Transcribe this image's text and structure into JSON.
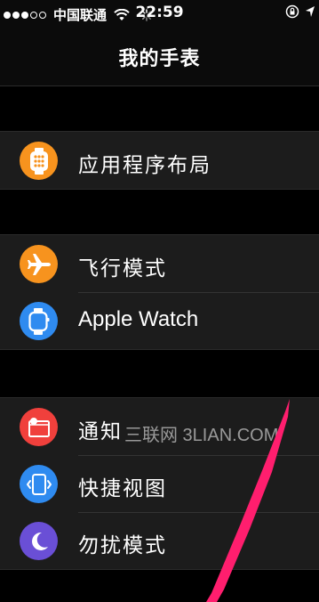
{
  "status_bar": {
    "carrier": "中国联通",
    "time": "22:59",
    "signal_dots_filled": 3,
    "signal_dots_total": 5
  },
  "nav": {
    "title": "我的手表"
  },
  "groups": [
    [
      {
        "label": "应用程序布局",
        "icon": "watch-app-grid-icon",
        "color": "#f7931e"
      }
    ],
    [
      {
        "label": "飞行模式",
        "icon": "airplane-icon",
        "color": "#f7931e"
      },
      {
        "label": "Apple Watch",
        "icon": "apple-watch-icon",
        "color": "#2f8bf0"
      }
    ],
    [
      {
        "label": "通知",
        "icon": "notification-icon",
        "color": "#f0403c"
      },
      {
        "label": "快捷视图",
        "icon": "glances-icon",
        "color": "#2f8bf0"
      },
      {
        "label": "勿扰模式",
        "icon": "moon-icon",
        "color": "#6a4fd6"
      }
    ]
  ],
  "watermark": "三联网 3LIAN.COM",
  "colors": {
    "background": "#000000",
    "cell": "#1c1c1c",
    "annotation": "#ff1e6e"
  }
}
